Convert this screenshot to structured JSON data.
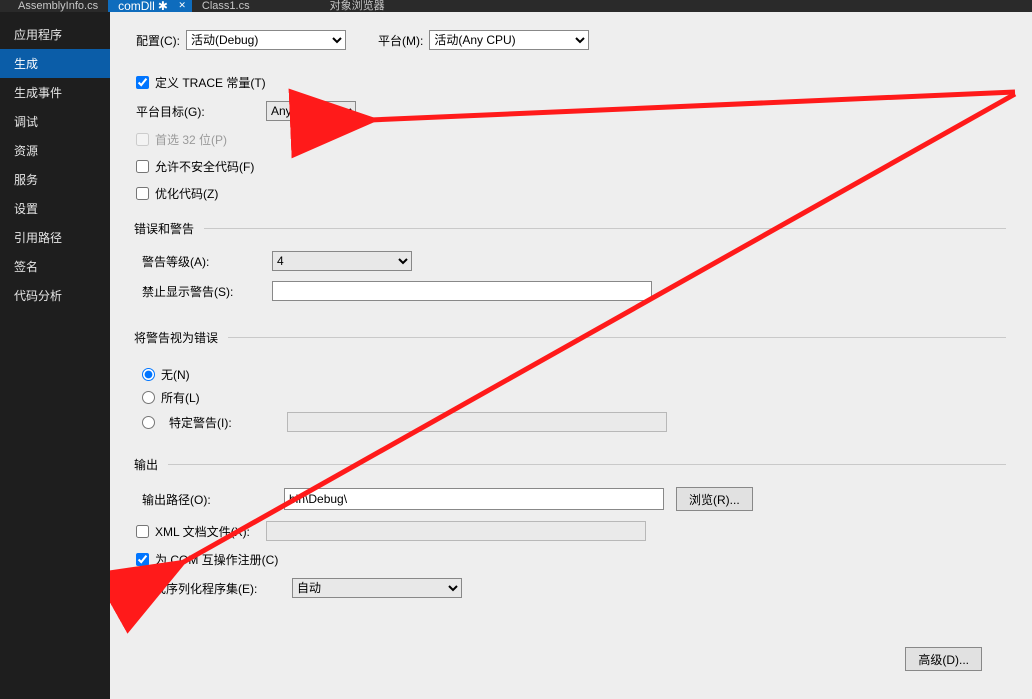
{
  "tabs": {
    "t0": "AssemblyInfo.cs",
    "t1_prefix": "comDll",
    "t1_star": "✱",
    "t2": "Class1.cs",
    "t3": "对象浏览器"
  },
  "sidebar": {
    "items": [
      "应用程序",
      "生成",
      "生成事件",
      "调试",
      "资源",
      "服务",
      "设置",
      "引用路径",
      "签名",
      "代码分析"
    ]
  },
  "top": {
    "config_label": "配置(C):",
    "config_value": "活动(Debug)",
    "platform_label": "平台(M):",
    "platform_value": "活动(Any CPU)"
  },
  "general": {
    "trace_label": "定义 TRACE 常量(T)",
    "target_label": "平台目标(G):",
    "target_value": "Any CPU",
    "prefer32_label": "首选 32 位(P)",
    "unsafe_label": "允许不安全代码(F)",
    "optimize_label": "优化代码(Z)"
  },
  "warn": {
    "group_label": "错误和警告",
    "level_label": "警告等级(A):",
    "level_value": "4",
    "suppress_label": "禁止显示警告(S):",
    "suppress_value": ""
  },
  "treat": {
    "group_label": "将警告视为错误",
    "none_label": "无(N)",
    "all_label": "所有(L)",
    "specific_label": "特定警告(I):"
  },
  "output": {
    "group_label": "输出",
    "path_label": "输出路径(O):",
    "path_value": "bin\\Debug\\",
    "browse_label": "浏览(R)...",
    "xml_label": "XML 文档文件(X):",
    "com_label": "为 COM 互操作注册(C)",
    "serial_label": "生成序列化程序集(E):",
    "serial_value": "自动"
  },
  "buttons": {
    "advanced": "高级(D)..."
  }
}
